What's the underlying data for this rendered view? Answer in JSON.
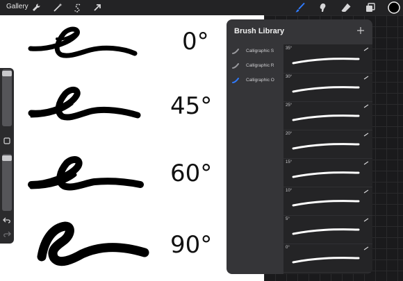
{
  "toolbar": {
    "gallery_label": "Gallery",
    "left_tools": [
      "wrench-icon",
      "magic-wand-icon",
      "selection-icon",
      "transform-arrow-icon"
    ],
    "right_tools": [
      "brush-icon",
      "smudge-icon",
      "eraser-icon",
      "layers-icon",
      "color-icon"
    ],
    "accent_color": "#2f7bff",
    "current_color": "#000000"
  },
  "canvas": {
    "rows": [
      {
        "label": "0°"
      },
      {
        "label": "45°"
      },
      {
        "label": "60°"
      },
      {
        "label": "90°"
      }
    ]
  },
  "sidebar": {
    "icons": [
      "square-modify-icon",
      "undo-icon",
      "redo-icon"
    ]
  },
  "brush_library": {
    "title": "Brush Library",
    "add_icon": "plus-icon",
    "sets": [
      {
        "label": "Calligraphic S",
        "selected": false
      },
      {
        "label": "Calligraphic R",
        "selected": false
      },
      {
        "label": "Calligraphic O",
        "selected": true
      }
    ],
    "brushes": [
      {
        "label": "35°"
      },
      {
        "label": "30°"
      },
      {
        "label": "25°"
      },
      {
        "label": "20°"
      },
      {
        "label": "15°"
      },
      {
        "label": "10°"
      },
      {
        "label": "5°"
      },
      {
        "label": "0°"
      }
    ]
  }
}
